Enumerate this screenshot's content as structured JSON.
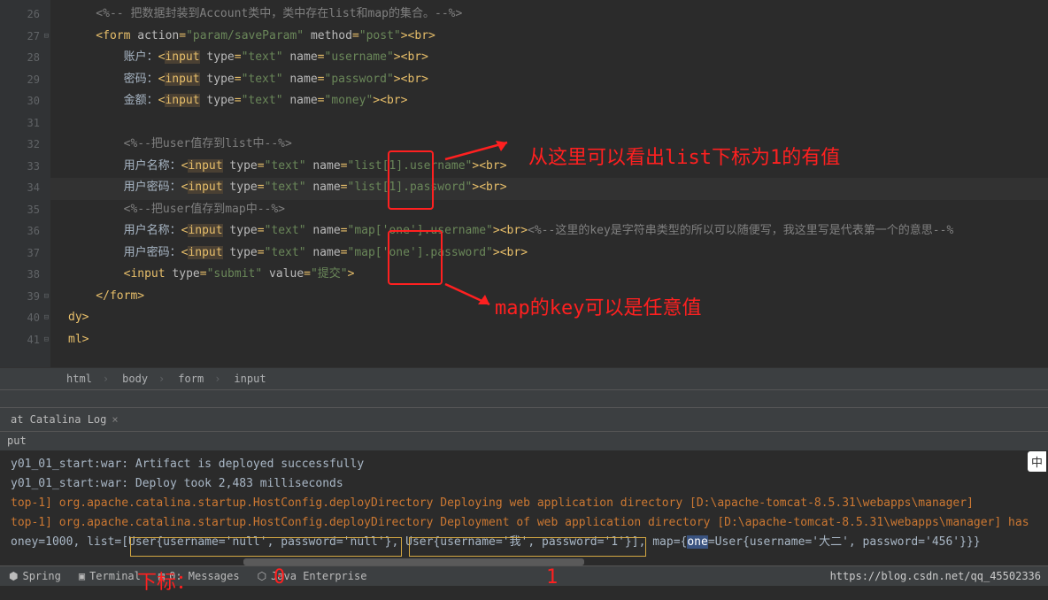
{
  "gutter": [
    "26",
    "27",
    "28",
    "29",
    "30",
    "31",
    "32",
    "33",
    "34",
    "35",
    "36",
    "37",
    "38",
    "39",
    "40",
    "41"
  ],
  "code": {
    "l26": "<%-- 把数据封装到Account类中，类中存在list和map的集合。--%>",
    "form_action": "param/saveParam",
    "form_method": "post",
    "label_account": "账户：",
    "label_password": "密码：",
    "label_money": "金额：",
    "name_username": "username",
    "name_password": "password",
    "name_money": "money",
    "comment_list": "<%--把user值存到list中--%>",
    "label_user_name": "用户名称：",
    "label_user_pwd": "用户密码：",
    "list_username": "list[1].username",
    "list_password": "list[1].password",
    "comment_map": "<%--把user值存到map中--%>",
    "map_username": "map['one'].username",
    "map_password": "map['one'].password",
    "map_comment": "<%--这里的key是字符串类型的所以可以随便写，我这里写是代表第一个的意思--%>",
    "submit_value": "提交"
  },
  "breadcrumb": [
    "html",
    "body",
    "form",
    "input"
  ],
  "tabs": {
    "log": "at Catalina Log",
    "output": "put"
  },
  "console": {
    "l1": "y01_01_start:war: Artifact is deployed successfully",
    "l2": "y01_01_start:war: Deploy took 2,483 milliseconds",
    "l3": "top-1] org.apache.catalina.startup.HostConfig.deployDirectory Deploying web application directory [D:\\apache-tomcat-8.5.31\\webapps\\manager]",
    "l4": "top-1] org.apache.catalina.startup.HostConfig.deployDirectory Deployment of web application directory [D:\\apache-tomcat-8.5.31\\webapps\\manager] has",
    "l5_a": "oney=1000, list=[User{username='null', password='null'}, User{username='我', password='1'}], map={",
    "l5_key": "one",
    "l5_b": "=User{username='大二', password='456'}}}"
  },
  "annotations": {
    "a1": "从这里可以看出list下标为1的有值",
    "a2": "map的key可以是任意值",
    "index_label": "下标：",
    "idx0": "0",
    "idx1": "1"
  },
  "status": {
    "spring": "Spring",
    "terminal": "Terminal",
    "messages": "0: Messages",
    "java": "Java Enterprise"
  },
  "watermark": "https://blog.csdn.net/qq_45502336",
  "marker": "中"
}
